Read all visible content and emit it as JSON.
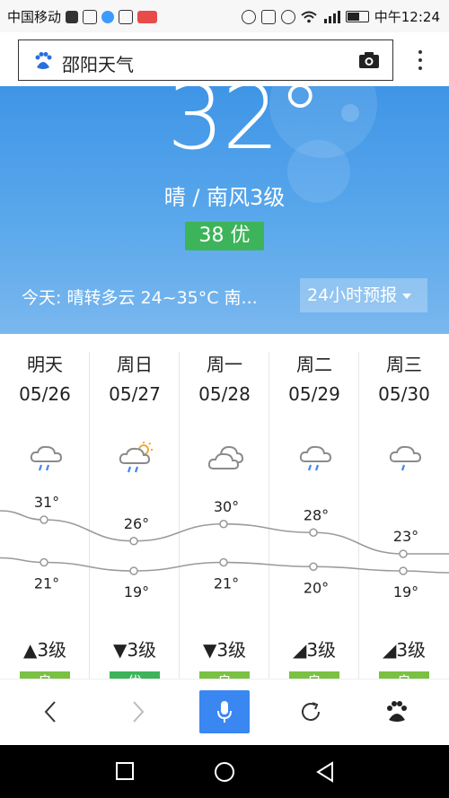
{
  "status_bar": {
    "carrier": "中国移动",
    "time": "中午12:24"
  },
  "search_bar": {
    "title": "邵阳天气"
  },
  "current": {
    "temperature": "32°",
    "condition": "晴 / 南风3级",
    "aqi": "38 优",
    "today": "今天:  晴转多云   24~35°C   南...",
    "hourly_button": "24小时预报"
  },
  "forecast": [
    {
      "day": "明天",
      "date": "05/26",
      "high": "31°",
      "low": "21°",
      "wind": "3级",
      "quality": "良",
      "icon": "rain-cloud-icon"
    },
    {
      "day": "周日",
      "date": "05/27",
      "high": "26°",
      "low": "19°",
      "wind": "3级",
      "quality": "优",
      "icon": "sun-rain-cloud-icon"
    },
    {
      "day": "周一",
      "date": "05/28",
      "high": "30°",
      "low": "21°",
      "wind": "3级",
      "quality": "良",
      "icon": "cloudy-icon"
    },
    {
      "day": "周二",
      "date": "05/29",
      "high": "28°",
      "low": "20°",
      "wind": "3级",
      "quality": "良",
      "icon": "rain-cloud-icon"
    },
    {
      "day": "周三",
      "date": "05/30",
      "high": "23°",
      "low": "19°",
      "wind": "3级",
      "quality": "良",
      "icon": "rain-cloud-icon"
    }
  ],
  "highs": [
    31,
    26,
    30,
    28,
    23
  ],
  "lows": [
    21,
    19,
    21,
    20,
    19
  ],
  "colors": {
    "accent": "#3a87f2",
    "hero_top": "#3f95e6",
    "quality_excellent": "#3db45a",
    "quality_good": "#7ac143"
  }
}
